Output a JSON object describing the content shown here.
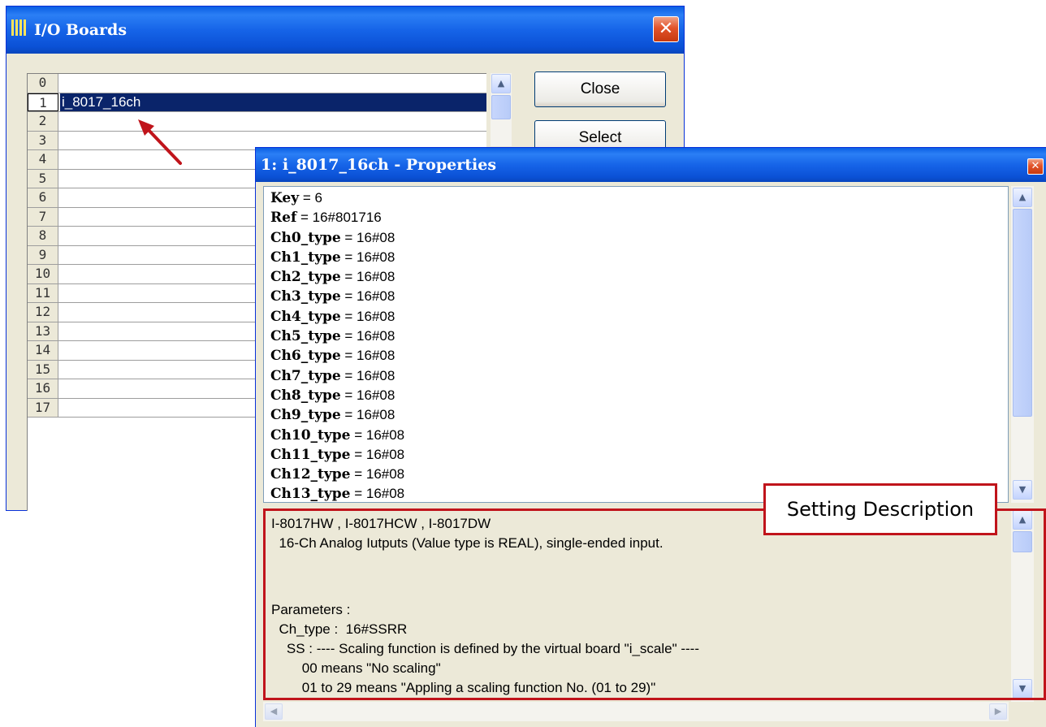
{
  "io_window": {
    "title": "I/O Boards",
    "close_glyph": "✕",
    "buttons": {
      "close": "Close",
      "select": "Select"
    },
    "rows": [
      {
        "num": "0",
        "name": ""
      },
      {
        "num": "1",
        "name": "i_8017_16ch",
        "selected": true
      },
      {
        "num": "2",
        "name": ""
      },
      {
        "num": "3",
        "name": ""
      },
      {
        "num": "4",
        "name": ""
      },
      {
        "num": "5",
        "name": ""
      },
      {
        "num": "6",
        "name": ""
      },
      {
        "num": "7",
        "name": ""
      },
      {
        "num": "8",
        "name": ""
      },
      {
        "num": "9",
        "name": ""
      },
      {
        "num": "10",
        "name": ""
      },
      {
        "num": "11",
        "name": ""
      },
      {
        "num": "12",
        "name": ""
      },
      {
        "num": "13",
        "name": ""
      },
      {
        "num": "14",
        "name": ""
      },
      {
        "num": "15",
        "name": ""
      },
      {
        "num": "16",
        "name": ""
      },
      {
        "num": "17",
        "name": ""
      }
    ]
  },
  "props_window": {
    "title": "1: i_8017_16ch - Properties",
    "close_glyph": "✕",
    "properties": [
      {
        "key": "Key",
        "value": "6"
      },
      {
        "key": "Ref",
        "value": "16#801716"
      },
      {
        "key": "Ch0_type",
        "value": "16#08"
      },
      {
        "key": "Ch1_type",
        "value": "16#08"
      },
      {
        "key": "Ch2_type",
        "value": "16#08"
      },
      {
        "key": "Ch3_type",
        "value": "16#08"
      },
      {
        "key": "Ch4_type",
        "value": "16#08"
      },
      {
        "key": "Ch5_type",
        "value": "16#08"
      },
      {
        "key": "Ch6_type",
        "value": "16#08"
      },
      {
        "key": "Ch7_type",
        "value": "16#08"
      },
      {
        "key": "Ch8_type",
        "value": "16#08"
      },
      {
        "key": "Ch9_type",
        "value": "16#08"
      },
      {
        "key": "Ch10_type",
        "value": "16#08"
      },
      {
        "key": "Ch11_type",
        "value": "16#08"
      },
      {
        "key": "Ch12_type",
        "value": "16#08"
      },
      {
        "key": "Ch13_type",
        "value": "16#08"
      }
    ],
    "description": [
      "I-8017HW , I-8017HCW , I-8017DW",
      "  16-Ch Analog Iutputs (Value type is REAL), single-ended input.",
      "",
      "Parameters :",
      "  Ch_type :  16#SSRR",
      "    SS : ---- Scaling function is defined by the virtual board \"i_scale\" ----",
      "        00 means \"No scaling\"",
      "        01 to 29 means \"Appling a scaling function No. (01 to 29)\""
    ]
  },
  "annotation": {
    "callout": "Setting Description",
    "color": "#c0141b"
  },
  "icons": {
    "title_icon": "grid-icon",
    "scroll_up": "▲",
    "scroll_down": "▼",
    "scroll_left": "◀",
    "scroll_right": "▶"
  }
}
